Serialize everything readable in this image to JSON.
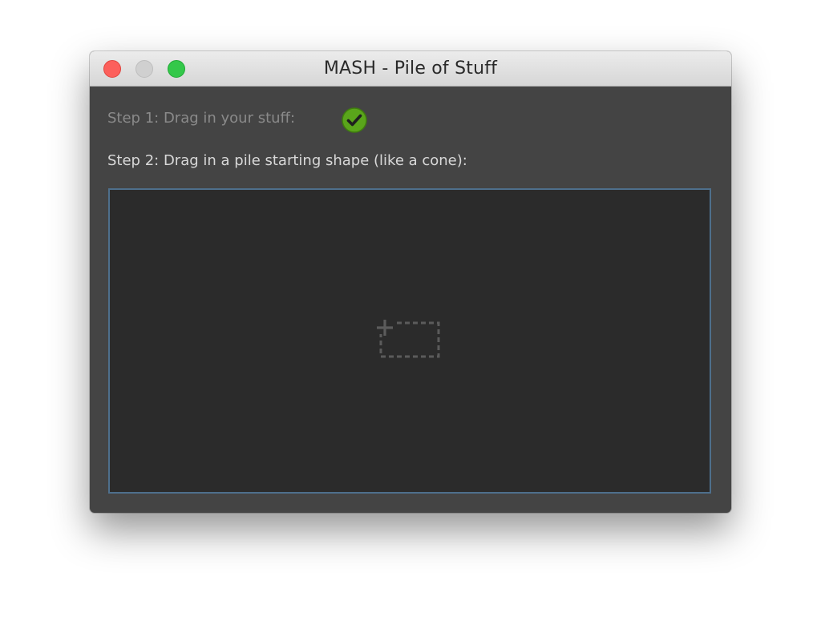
{
  "window": {
    "title": "MASH - Pile of Stuff",
    "controls": {
      "close_color": "#fc605c",
      "minimize_color": "#d0d0d0",
      "zoom_color": "#34c84a"
    }
  },
  "steps": {
    "step1_label": "Step 1: Drag in your stuff:",
    "step1_status_icon": "checkmark-circle-icon",
    "step1_status_color": "#5aa51b",
    "step2_label": "Step 2: Drag in a pile starting shape (like a cone):"
  },
  "dropzone": {
    "icon": "add-dashed-rect-icon",
    "border_color": "#4e6f8c",
    "background": "#2b2b2b"
  }
}
